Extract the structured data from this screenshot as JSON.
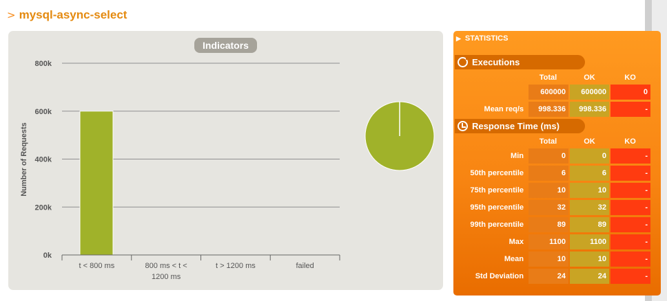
{
  "page": {
    "title_chevron": ">",
    "title": "mysql-async-select"
  },
  "indicators": {
    "badge": "Indicators"
  },
  "chart_data": {
    "type": "bar",
    "categories": [
      "t < 800 ms",
      "800 ms < t < 1200 ms",
      "t > 1200 ms",
      "failed"
    ],
    "category_lines": [
      [
        "t < 800 ms"
      ],
      [
        "800 ms < t <",
        "1200 ms"
      ],
      [
        "t > 1200 ms"
      ],
      [
        "failed"
      ]
    ],
    "values": [
      600000,
      0,
      0,
      0
    ],
    "ylabel": "Number of Requests",
    "ylim": [
      0,
      800000
    ],
    "yticks": [
      0,
      200000,
      400000,
      600000,
      800000
    ],
    "ytick_labels": [
      "0k",
      "200k",
      "400k",
      "600k",
      "800k"
    ],
    "grid": true,
    "bar_color": "#a0b22a",
    "pie": {
      "type": "pie",
      "values": [
        600000,
        0,
        0,
        0
      ],
      "colors": [
        "#a0b22a",
        "#f7a61d",
        "#f15b2a",
        "#e02b26"
      ]
    }
  },
  "statistics": {
    "header_icon": "triangle-right-icon",
    "header": "STATISTICS",
    "columns": [
      "Total",
      "OK",
      "KO"
    ],
    "executions": {
      "icon": "refresh-icon",
      "label": "Executions",
      "rows": [
        {
          "label": "",
          "total": "600000",
          "ok": "600000",
          "ko": "0"
        },
        {
          "label": "Mean req/s",
          "total": "998.336",
          "ok": "998.336",
          "ko": "-"
        }
      ]
    },
    "response_time": {
      "icon": "clock-icon",
      "label": "Response Time (ms)",
      "rows": [
        {
          "label": "Min",
          "total": "0",
          "ok": "0",
          "ko": "-"
        },
        {
          "label": "50th percentile",
          "total": "6",
          "ok": "6",
          "ko": "-"
        },
        {
          "label": "75th percentile",
          "total": "10",
          "ok": "10",
          "ko": "-"
        },
        {
          "label": "95th percentile",
          "total": "32",
          "ok": "32",
          "ko": "-"
        },
        {
          "label": "99th percentile",
          "total": "89",
          "ok": "89",
          "ko": "-"
        },
        {
          "label": "Max",
          "total": "1100",
          "ok": "1100",
          "ko": "-"
        },
        {
          "label": "Mean",
          "total": "10",
          "ok": "10",
          "ko": "-"
        },
        {
          "label": "Std Deviation",
          "total": "24",
          "ok": "24",
          "ko": "-"
        }
      ]
    }
  }
}
